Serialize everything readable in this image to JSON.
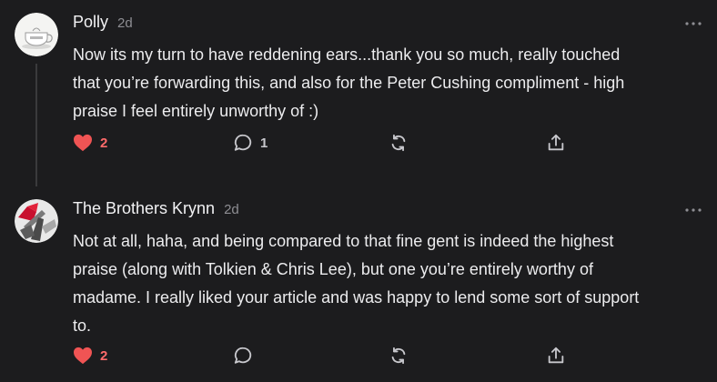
{
  "colors": {
    "background": "#1c1c1e",
    "heart": "#f05454",
    "icon": "#c7c7cc",
    "thread_line": "#3a3a3c"
  },
  "comments": [
    {
      "author": "Polly",
      "age": "2d",
      "lines": [
        "Now its my turn to have reddening ears...thank you so much, really touched",
        "that you’re forwarding this, and also for the Peter Cushing compliment - high",
        "praise I feel entirely unworthy of :)"
      ],
      "likes": "2",
      "replies": "1",
      "icons": {
        "like": "heart-icon",
        "reply": "comment-icon",
        "restack": "restack-icon",
        "share": "share-icon",
        "more": "more-dots-icon"
      }
    },
    {
      "author": "The Brothers Krynn",
      "age": "2d",
      "lines": [
        "Not at all, haha, and being compared to that fine gent is indeed the highest",
        "praise (along with Tolkien & Chris Lee), but one you’re entirely worthy of",
        "madame. I really liked your article and was happy to lend some sort of support",
        "to."
      ],
      "likes": "2",
      "replies": "",
      "icons": {
        "like": "heart-icon",
        "reply": "comment-icon",
        "restack": "restack-icon",
        "share": "share-icon",
        "more": "more-dots-icon"
      }
    }
  ]
}
